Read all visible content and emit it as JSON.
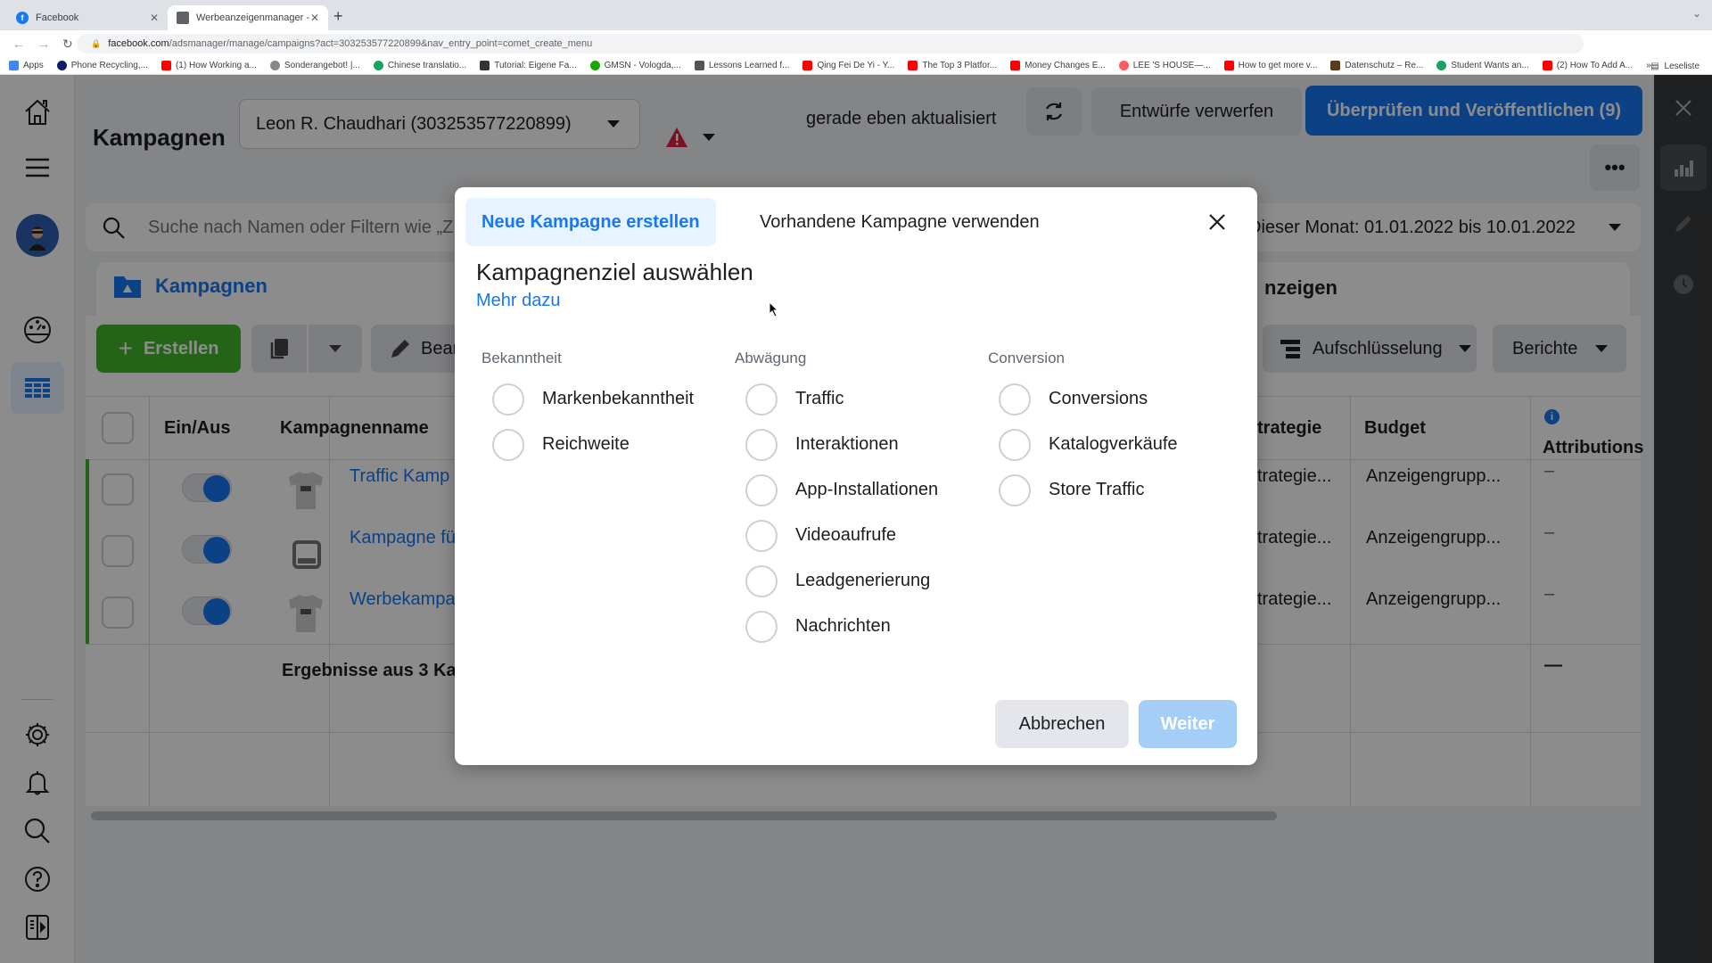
{
  "browser": {
    "tabs": [
      {
        "title": "Facebook",
        "icon": "facebook-icon",
        "active": false
      },
      {
        "title": "Werbeanzeigenmanager - Wer",
        "icon": "ads-manager-icon",
        "active": true
      }
    ],
    "new_tab_label": "+",
    "url_host": "facebook.com",
    "url_path": "/adsmanager/manage/campaigns?act=303253577220899&nav_entry_point=comet_create_menu",
    "bookmarks": [
      {
        "label": "Apps",
        "color": "#4285f4"
      },
      {
        "label": "Phone Recycling,...",
        "color": "#0a1e6a"
      },
      {
        "label": "(1) How Working a...",
        "color": "#ff0000"
      },
      {
        "label": "Sonderangebot! |...",
        "color": "#888888"
      },
      {
        "label": "Chinese translatio...",
        "color": "#1aa260"
      },
      {
        "label": "Tutorial: Eigene Fa...",
        "color": "#333333"
      },
      {
        "label": "GMSN - Vologda,...",
        "color": "#14a800"
      },
      {
        "label": "Lessons Learned f...",
        "color": "#555555"
      },
      {
        "label": "Qing Fei De Yi - Y...",
        "color": "#ff0000"
      },
      {
        "label": "The Top 3 Platfor...",
        "color": "#ff0000"
      },
      {
        "label": "Money Changes E...",
        "color": "#ff0000"
      },
      {
        "label": "LEE 'S HOUSE—...",
        "color": "#ff5a5f"
      },
      {
        "label": "How to get more v...",
        "color": "#ff0000"
      },
      {
        "label": "Datenschutz – Re...",
        "color": "#5a3b1e"
      },
      {
        "label": "Student Wants an...",
        "color": "#1aa260"
      },
      {
        "label": "(2) How To Add A...",
        "color": "#ff0000"
      }
    ],
    "more_bookmarks": "»",
    "reading_list": "Leseliste"
  },
  "header": {
    "title": "Kampagnen",
    "account": "Leon R. Chaudhari (303253577220899)",
    "updated": "gerade eben aktualisiert",
    "discard": "Entwürfe verwerfen",
    "publish": "Überprüfen und Veröffentlichen (9)",
    "more": "•••"
  },
  "search": {
    "placeholder": "Suche nach Namen oder Filtern wie „Z",
    "date_range": "Dieser Monat: 01.01.2022 bis 10.01.2022"
  },
  "tabs": {
    "campaigns": "Kampagnen",
    "ads": "nzeigen"
  },
  "toolbar": {
    "create": "Erstellen",
    "edit": "Bear",
    "breakdown": "Aufschlüsselung",
    "reports": "Berichte"
  },
  "table": {
    "headers": {
      "toggle": "Ein/Aus",
      "name": "Kampagnenname",
      "strategy": "trategie",
      "budget": "Budget",
      "attribution": "Attributions"
    },
    "rows": [
      {
        "name": "Traffic Kamp",
        "strategy": "trategie...",
        "budget": "Anzeigengrupp...",
        "attribution": "–",
        "on": true,
        "thumb": "tshirt"
      },
      {
        "name": "Kampagne fü",
        "strategy": "trategie...",
        "budget": "Anzeigengrupp...",
        "attribution": "–",
        "on": true,
        "thumb": "device"
      },
      {
        "name": "Werbekampa",
        "strategy": "trategie...",
        "budget": "Anzeigengrupp...",
        "attribution": "–",
        "on": true,
        "thumb": "tshirt"
      }
    ],
    "summary": "Ergebnisse aus 3 Ka",
    "summary_attribution": "—"
  },
  "modal": {
    "tab_new": "Neue Kampagne erstellen",
    "tab_existing": "Vorhandene Kampagne verwenden",
    "title": "Kampagnenziel auswählen",
    "learn_more": "Mehr dazu",
    "columns": [
      {
        "heading": "Bekanntheit",
        "options": [
          "Markenbekanntheit",
          "Reichweite"
        ]
      },
      {
        "heading": "Abwägung",
        "options": [
          "Traffic",
          "Interaktionen",
          "App-Installationen",
          "Videoaufrufe",
          "Leadgenerierung",
          "Nachrichten"
        ]
      },
      {
        "heading": "Conversion",
        "options": [
          "Conversions",
          "Katalogverkäufe",
          "Store Traffic"
        ]
      }
    ],
    "cancel": "Abbrechen",
    "next": "Weiter"
  },
  "colors": {
    "brand_blue": "#1877f2",
    "create_green": "#42b72a",
    "next_disabled": "#a4cdf8"
  }
}
